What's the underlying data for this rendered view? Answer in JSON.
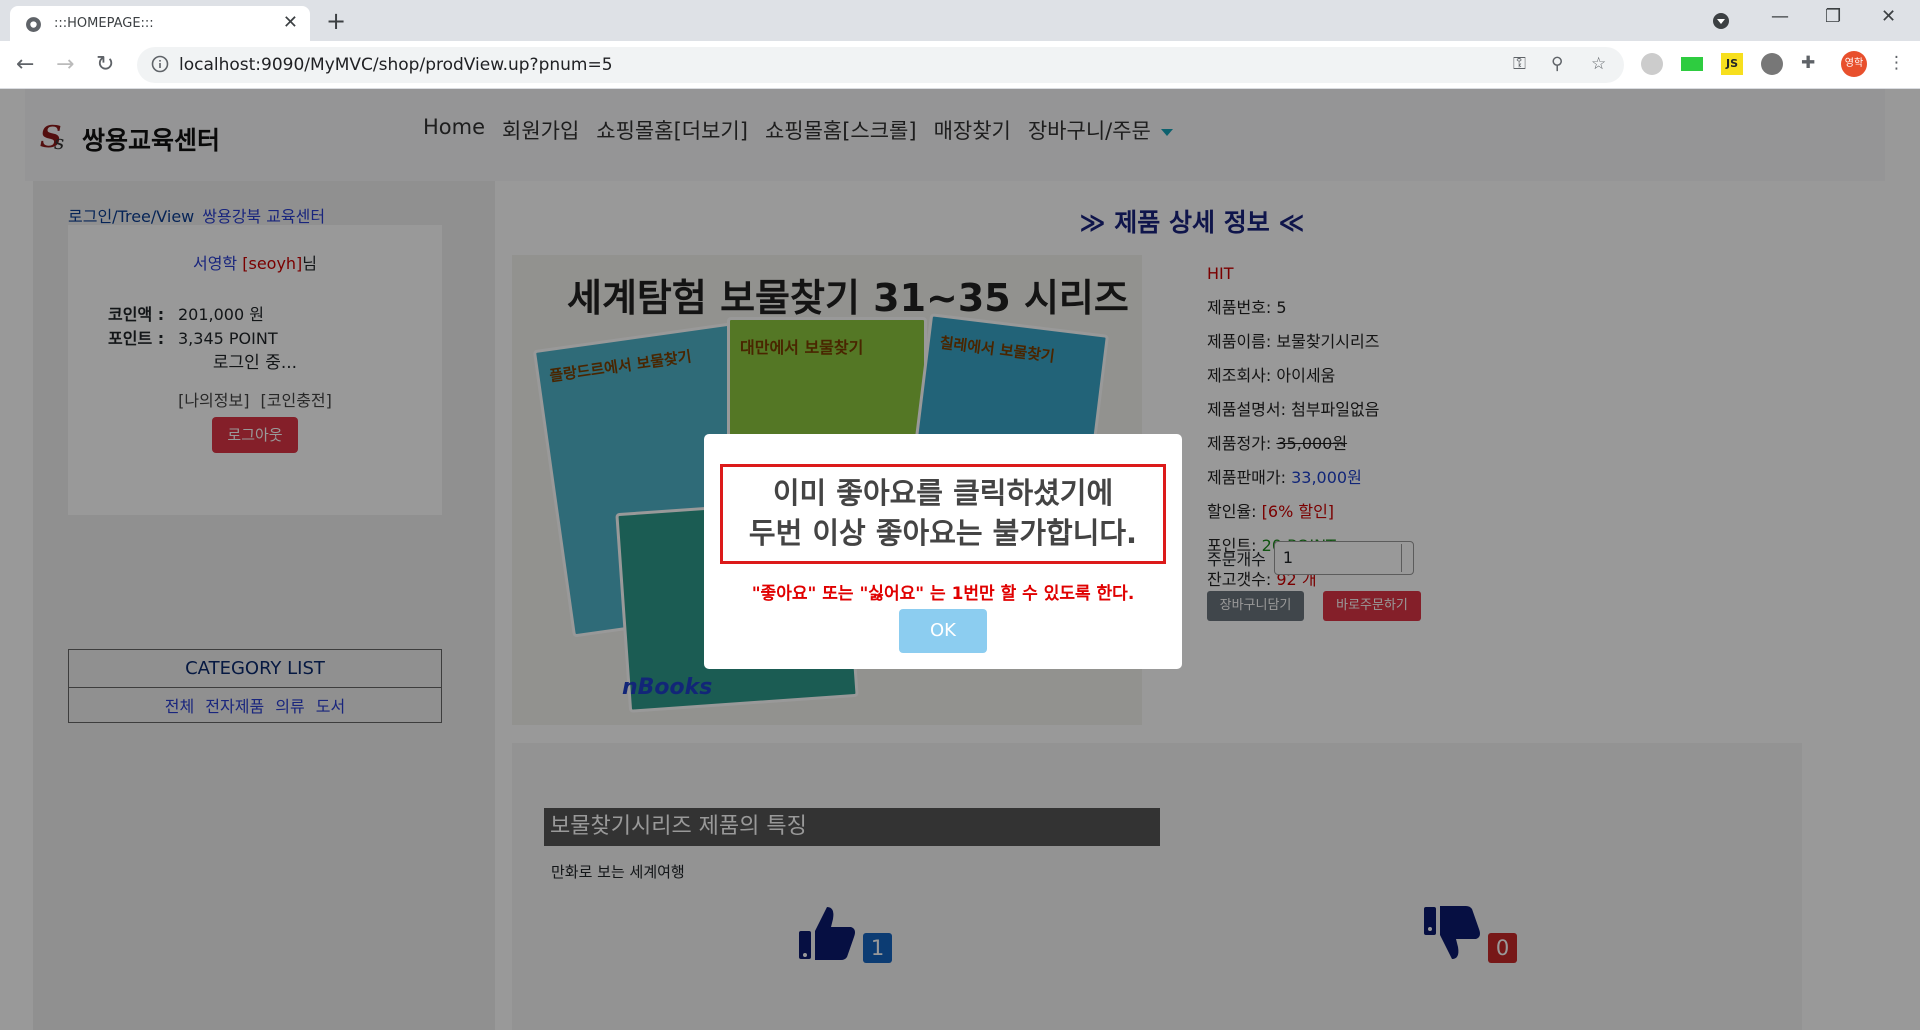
{
  "browser": {
    "tab_title": ":::HOMEPAGE:::",
    "url": "localhost:9090/MyMVC/shop/prodView.up?pnum=5",
    "profile_initial": "영학"
  },
  "header": {
    "logo_text": "쌍용교육센터",
    "nav": [
      "Home",
      "회원가입",
      "쇼핑몰홈[더보기]",
      "쇼핑몰홈[스크롤]",
      "매장찾기",
      "장바구니/주문"
    ]
  },
  "sidebar": {
    "link1": "로그인/Tree/View",
    "link2": "쌍용강북 교육센터",
    "user_name": "서영학",
    "user_id": "[seoyh]",
    "user_suffix": "님",
    "coin_label": "코인액 :",
    "coin_value": "201,000 원",
    "point_label": "포인트 :",
    "point_value": "3,345 POINT",
    "login_status": "로그인 중...",
    "links": "[나의정보] [코인충전]",
    "logout_label": "로그아웃",
    "category_title": "CATEGORY LIST",
    "categories": "전체 전자제품 의류 도서"
  },
  "product": {
    "detail_title": "≫ 제품 상세 정보 ≪",
    "image_heading": "세계탐험 보물찾기 31~35 시리즈",
    "book_titles": [
      "플랑드르에서 보물찾기",
      "대만에서 보물찾기",
      "칠레에서 보물찾기"
    ],
    "image_badge": "nBooks",
    "spec": "HIT",
    "pnum_label": "제품번호:",
    "pnum": "5",
    "name_label": "제품이름:",
    "name": "보물찾기시리즈",
    "company_label": "제조회사:",
    "company": "아이세움",
    "manual_label": "제품설명서:",
    "manual": "첨부파일없음",
    "price_label": "제품정가:",
    "price": "35,000원",
    "saleprice_label": "제품판매가:",
    "saleprice": "33,000원",
    "discount_label": "할인율:",
    "discount": "[6% 할인]",
    "point_label": "포인트:",
    "point": "20 POINT",
    "stock_label": "잔고갯수:",
    "stock": "92 개",
    "qty_label": "주문개수",
    "qty_value": "1",
    "cart_button": "장바구니담기",
    "buy_button": "바로주문하기",
    "feature_heading": "보물찾기시리즈 제품의 특징",
    "feature_text": "만화로 보는 세계여행",
    "like_count": "1",
    "dislike_count": "0"
  },
  "modal": {
    "message_line1": "이미 좋아요를 클릭하셨기에",
    "message_line2": "두번 이상 좋아요는 불가합니다.",
    "sub_message": "\"좋아요\" 또는 \"싫어요\" 는 1번만 할 수 있도록 한다.",
    "ok_label": "OK"
  }
}
